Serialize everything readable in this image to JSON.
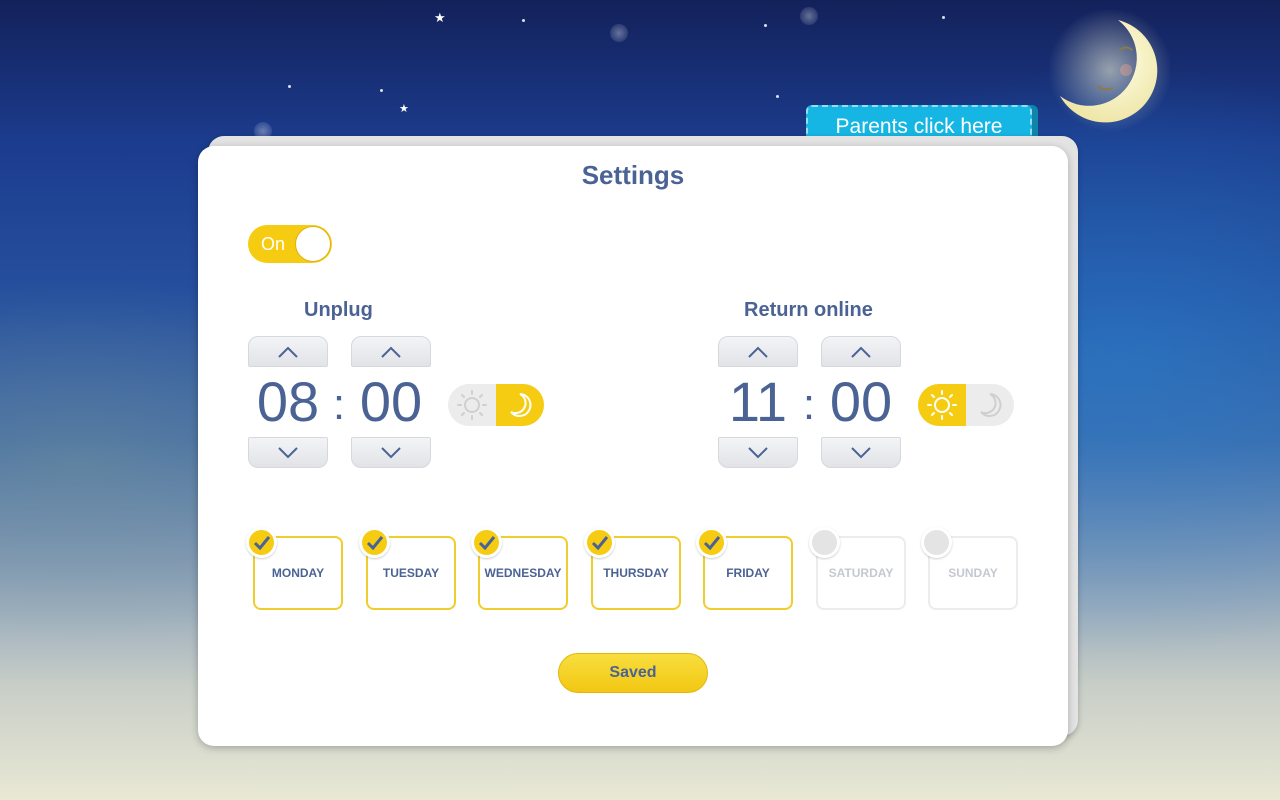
{
  "header": {
    "parents_tab_label": "Parents click here"
  },
  "settings": {
    "title": "Settings",
    "toggle_label": "On",
    "toggle_state": "on"
  },
  "unplug": {
    "title": "Unplug",
    "hour": "08",
    "separator": ":",
    "minute": "00",
    "period": "night"
  },
  "return_online": {
    "title": "Return online",
    "hour": "11",
    "separator": ":",
    "minute": "00",
    "period": "day"
  },
  "days": [
    {
      "label": "MONDAY",
      "checked": true
    },
    {
      "label": "TUESDAY",
      "checked": true
    },
    {
      "label": "WEDNESDAY",
      "checked": true
    },
    {
      "label": "THURSDAY",
      "checked": true
    },
    {
      "label": "FRIDAY",
      "checked": true
    },
    {
      "label": "SATURDAY",
      "checked": false
    },
    {
      "label": "SUNDAY",
      "checked": false
    }
  ],
  "save_button_label": "Saved",
  "icons": {
    "moon_mascot": "crescent-moon-face-icon",
    "stepper_up": "chevron-up-icon",
    "stepper_down": "chevron-down-icon",
    "day": "sun-icon",
    "night": "moon-icon",
    "check": "checkmark-icon"
  },
  "colors": {
    "accent": "#f6cc13",
    "text": "#4b6394",
    "tab": "#16b6e4",
    "disabled": "#c5c8d0"
  }
}
